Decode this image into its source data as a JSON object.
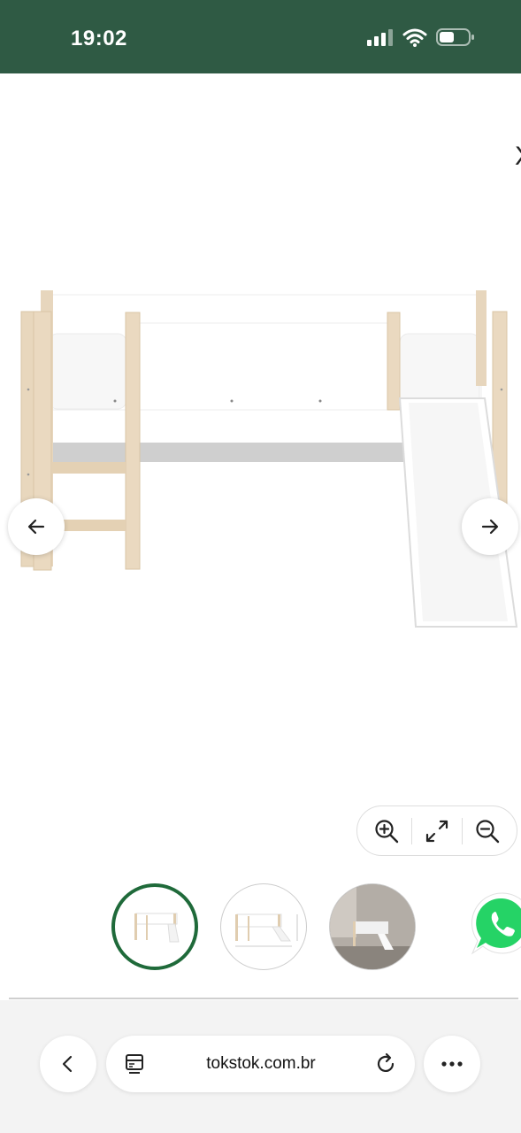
{
  "status_bar": {
    "time": "19:02",
    "icons": [
      "cellular-signal-icon",
      "wifi-icon",
      "battery-icon"
    ],
    "background": "#2f5a44"
  },
  "viewer": {
    "close_glyph": "X",
    "prev_icon": "arrow-left-icon",
    "next_icon": "arrow-right-icon",
    "zoom_controls": [
      "zoom-in-icon",
      "fullscreen-icon",
      "zoom-out-icon"
    ],
    "active_thumbnail": 1,
    "thumbnails": [
      {
        "name": "product-front-view",
        "selected": true
      },
      {
        "name": "product-dimensions-view",
        "selected": false
      },
      {
        "name": "product-room-view",
        "selected": false
      }
    ],
    "accent": "#1f6a3a"
  },
  "whatsapp": {
    "icon": "whatsapp-icon",
    "color": "#25d366"
  },
  "browser": {
    "url": "tokstok.com.br",
    "back_icon": "chevron-left-icon",
    "page_icon": "reader-icon",
    "reload_icon": "reload-icon",
    "more_icon": "more-dots-icon"
  }
}
